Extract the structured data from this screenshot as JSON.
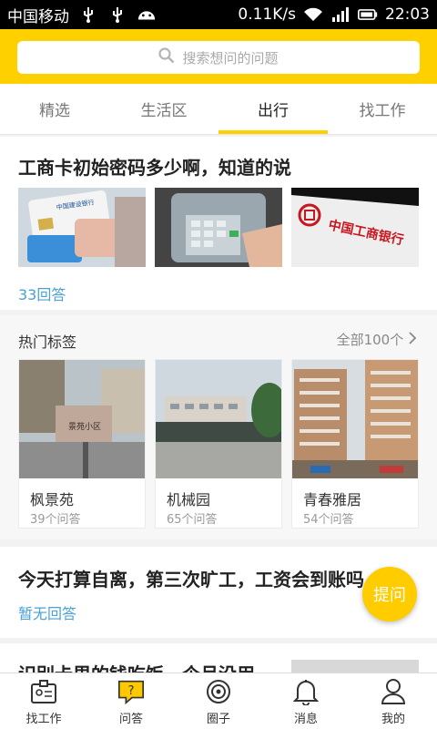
{
  "status_bar": {
    "carrier": "中国移动",
    "speed": "0.11K/s",
    "time": "22:03",
    "icons": [
      "usb-icon",
      "usb-icon",
      "android-icon",
      "wifi-icon",
      "signal-icon",
      "battery-icon"
    ]
  },
  "search": {
    "placeholder": "搜索想问的问题",
    "icon": "search-icon"
  },
  "tabs": [
    {
      "label": "精选",
      "active": false
    },
    {
      "label": "生活区",
      "active": false
    },
    {
      "label": "出行",
      "active": true
    },
    {
      "label": "找工作",
      "active": false
    }
  ],
  "question1": {
    "title": "工商卡初始密码多少啊，知道的说",
    "answers": "33回答"
  },
  "hot_tags": {
    "title": "热门标签",
    "all_label": "全部100个",
    "items": [
      {
        "name": "枫景苑",
        "count": "39个问答",
        "sign": "景苑小区"
      },
      {
        "name": "机械园",
        "count": "65个问答"
      },
      {
        "name": "青春雅居",
        "count": "54个问答"
      }
    ]
  },
  "question2": {
    "title": "今天打算自离，第三次旷工，工资会到账吗",
    "answers": "暂无回答"
  },
  "question3": {
    "title": "识别卡里的钱吃饭一个月没用"
  },
  "fab": {
    "label": "提问"
  },
  "bottom_nav": [
    {
      "label": "找工作",
      "icon": "id-card-icon"
    },
    {
      "label": "问答",
      "icon": "qa-icon",
      "active": true
    },
    {
      "label": "圈子",
      "icon": "circle-icon"
    },
    {
      "label": "消息",
      "icon": "bell-icon"
    },
    {
      "label": "我的",
      "icon": "user-icon"
    }
  ],
  "colors": {
    "accent": "#ffd000",
    "link": "#4aa0d8"
  },
  "images": {
    "card_bank_logo_text": "中国建设银行",
    "icbc_sign_text": "中国工商银行"
  }
}
